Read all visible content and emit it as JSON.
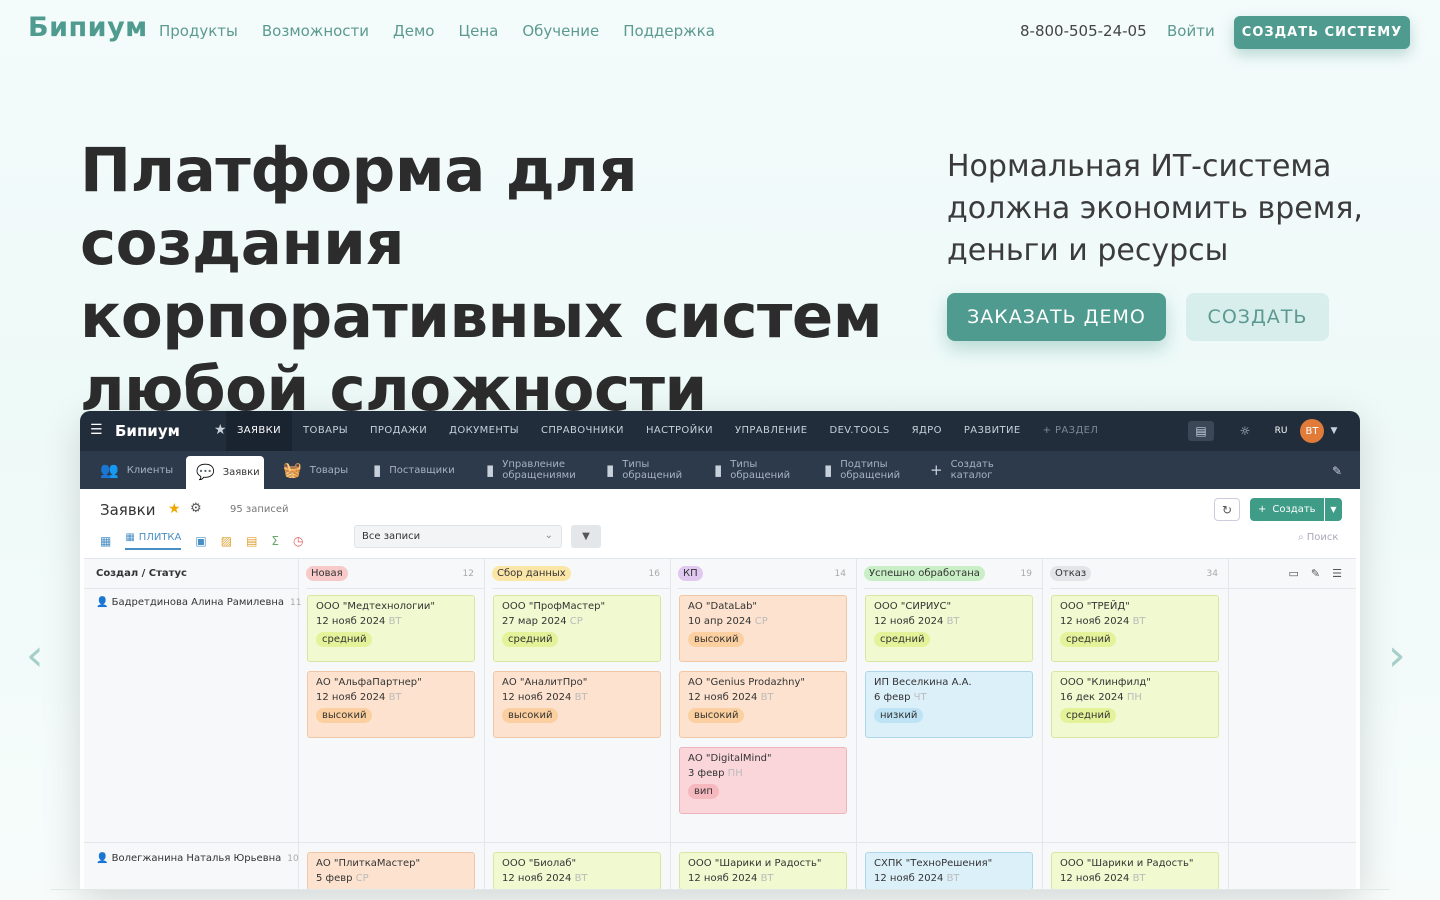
{
  "header": {
    "logo": "Бипиум",
    "nav": [
      "Продукты",
      "Возможности",
      "Демо",
      "Цена",
      "Обучение",
      "Поддержка"
    ],
    "phone": "8-800-505-24-05",
    "login": "Войти",
    "cta": "СОЗДАТЬ СИСТЕМУ"
  },
  "hero": {
    "title": "Платформа для создания корпоративных систем любой сложности",
    "subtitle": "Нормальная ИТ-система должна экономить время, деньги и ресурсы",
    "demo_btn": "ЗАКАЗАТЬ ДЕМО",
    "create_btn": "СОЗДАТЬ"
  },
  "app": {
    "brand": "Бипиум",
    "menu": [
      "ЗАЯВКИ",
      "ТОВАРЫ",
      "ПРОДАЖИ",
      "ДОКУМЕНТЫ",
      "СПРАВОЧНИКИ",
      "НАСТРОЙКИ",
      "УПРАВЛЕНИЕ",
      "DEV.TOOLS",
      "ЯДРО",
      "РАЗВИТИЕ",
      "+ РАЗДЕЛ"
    ],
    "lang": "RU",
    "avatar": "BT",
    "tabs": [
      "Клиенты",
      "Заявки",
      "Товары",
      "Поставщики",
      "Управление обращениями",
      "Типы обращений",
      "Типы обращений",
      "Подтипы обращений",
      "Создать каталог"
    ],
    "page_title": "Заявки",
    "count": "95 записей",
    "create_label": "Создать",
    "view_label": "ПЛИТКА",
    "filter": "Все записи",
    "search": "Поиск",
    "row_header": "Создал / Статус",
    "columns": [
      {
        "name": "Новая",
        "count": "12",
        "color": "#f7c9c9"
      },
      {
        "name": "Сбор данных",
        "count": "16",
        "color": "#fbe6a8"
      },
      {
        "name": "КП",
        "count": "14",
        "color": "#e0c8f0"
      },
      {
        "name": "Успешно обработана",
        "count": "19",
        "color": "#c9efc6"
      },
      {
        "name": "Отказ",
        "count": "34",
        "color": "#e3e5e8"
      }
    ],
    "rows": [
      {
        "name": "Бадретдинова Алина Рамилевна",
        "count": "11"
      },
      {
        "name": "Волегжанина Наталья Юрьевна",
        "count": "10"
      }
    ],
    "cards": [
      {
        "title": "ООО \"Медтехнологии\"",
        "date": "12 нояб 2024",
        "day": "ВТ",
        "priority": "средний",
        "theme": "yellow"
      },
      {
        "title": "АО \"АльфаПартнер\"",
        "date": "12 нояб 2024",
        "day": "ВТ",
        "priority": "высокий",
        "theme": "orange"
      },
      {
        "title": "ООО \"ПрофМастер\"",
        "date": "27 мар 2024",
        "day": "СР",
        "priority": "средний",
        "theme": "yellow"
      },
      {
        "title": "АО \"АналитПро\"",
        "date": "12 нояб 2024",
        "day": "ВТ",
        "priority": "высокий",
        "theme": "orange"
      },
      {
        "title": "АО \"DataLab\"",
        "date": "10 апр 2024",
        "day": "СР",
        "priority": "высокий",
        "theme": "orange"
      },
      {
        "title": "АО \"Genius Prodazhny\"",
        "date": "12 нояб 2024",
        "day": "ВТ",
        "priority": "высокий",
        "theme": "orange"
      },
      {
        "title": "АО \"DigitalMind\"",
        "date": "3 февр",
        "day": "ПН",
        "priority": "вип",
        "theme": "pink"
      },
      {
        "title": "ООО \"СИРИУС\"",
        "date": "12 нояб 2024",
        "day": "ВТ",
        "priority": "средний",
        "theme": "yellow"
      },
      {
        "title": "ИП Веселкина А.А.",
        "date": "6 февр",
        "day": "ЧТ",
        "priority": "низкий",
        "theme": "blue"
      },
      {
        "title": "ООО \"ТРЕЙД\"",
        "date": "12 нояб 2024",
        "day": "ВТ",
        "priority": "средний",
        "theme": "yellow"
      },
      {
        "title": "ООО \"Клинфилд\"",
        "date": "16 дек 2024",
        "day": "ПН",
        "priority": "средний",
        "theme": "yellow"
      },
      {
        "title": "АО \"ПлиткаМастер\"",
        "date": "5 февр",
        "day": "СР",
        "priority": "",
        "theme": "orange"
      },
      {
        "title": "ООО \"Биолаб\"",
        "date": "12 нояб 2024",
        "day": "ВТ",
        "priority": "",
        "theme": "yellow"
      },
      {
        "title": "ООО \"Шарики и Радость\"",
        "date": "12 нояб 2024",
        "day": "ВТ",
        "priority": "",
        "theme": "yellow"
      },
      {
        "title": "СХПК \"ТехноРешения\"",
        "date": "12 нояб 2024",
        "day": "ВТ",
        "priority": "",
        "theme": "blue"
      },
      {
        "title": "ООО \"Шарики и Радость\"",
        "date": "12 нояб 2024",
        "day": "ВТ",
        "priority": "",
        "theme": "yellow"
      }
    ]
  }
}
